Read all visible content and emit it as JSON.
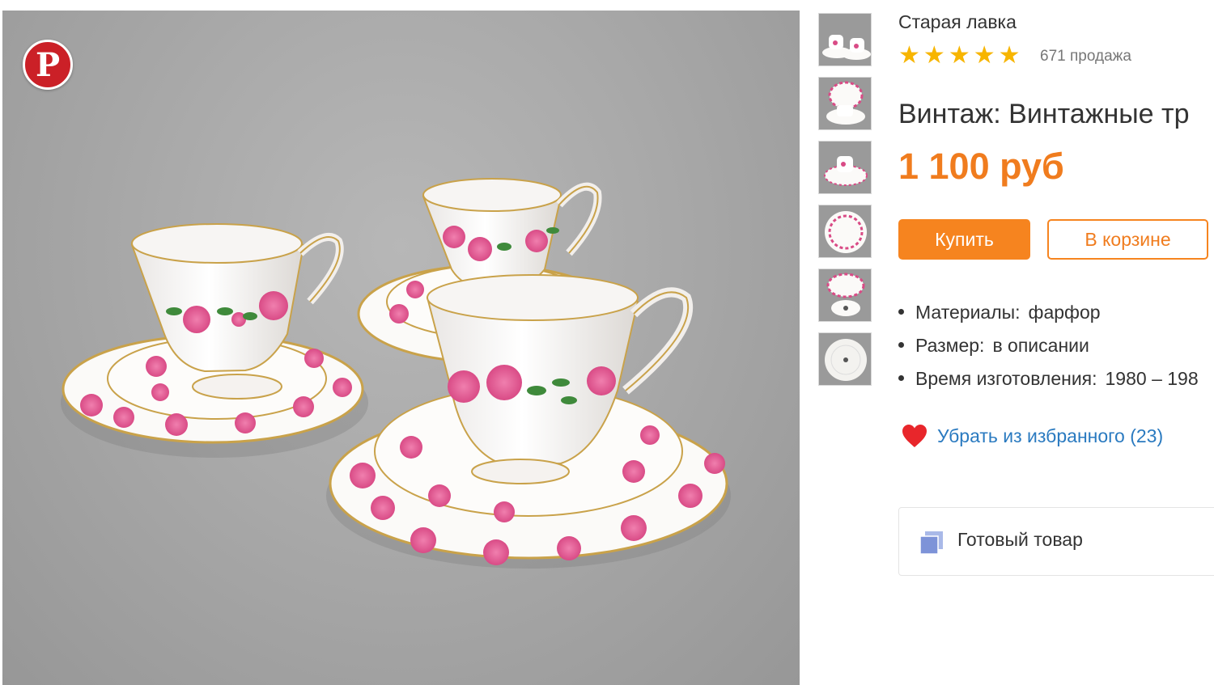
{
  "photo": {
    "alt_icon": "teacup-set-photo"
  },
  "pinterest": {
    "icon": "pinterest-icon",
    "glyph": "P"
  },
  "thumbnails": [
    {
      "icon": "thumbnail-cups"
    },
    {
      "icon": "thumbnail-plate-cup"
    },
    {
      "icon": "thumbnail-trio"
    },
    {
      "icon": "thumbnail-plate"
    },
    {
      "icon": "thumbnail-plate-stamp"
    },
    {
      "icon": "thumbnail-bottom"
    }
  ],
  "shop": {
    "name": "Старая лавка",
    "rating_stars": 5,
    "star_glyph": "★",
    "sales": "671 продажа"
  },
  "product": {
    "title": "Винтаж: Винтажные тр",
    "price": "1 100 руб"
  },
  "buttons": {
    "buy": "Купить",
    "cart": "В корзине"
  },
  "properties": [
    {
      "label": "Материалы:",
      "value": "фарфор"
    },
    {
      "label": "Размер:",
      "value": "в описании"
    },
    {
      "label": "Время изготовления:",
      "value": "1980 – 198"
    }
  ],
  "favorite": {
    "icon": "heart-icon",
    "label": "Убрать из избранного (23)"
  },
  "ready": {
    "icon": "box-icon",
    "label": "Готовый товар"
  },
  "colors": {
    "accent": "#f6841f",
    "price": "#f07c1e",
    "link": "#2a7ac0",
    "heart": "#e8262b",
    "star": "#f7b500",
    "pinterest": "#cb2027"
  }
}
